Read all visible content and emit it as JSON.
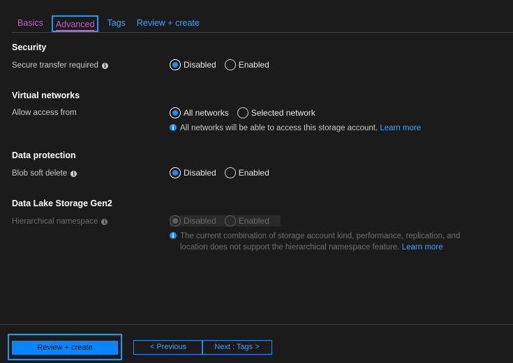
{
  "tabs": {
    "basics": "Basics",
    "advanced": "Advanced",
    "tags": "Tags",
    "review": "Review + create"
  },
  "security": {
    "title": "Security",
    "secure_transfer_label": "Secure transfer required",
    "option_disabled": "Disabled",
    "option_enabled": "Enabled",
    "selected": "Disabled"
  },
  "virtual_networks": {
    "title": "Virtual networks",
    "allow_access_label": "Allow access from",
    "option_all": "All networks",
    "option_selected": "Selected network",
    "selected": "All networks",
    "info_text": "All networks will be able to access this storage account.",
    "learn_more": "Learn more"
  },
  "data_protection": {
    "title": "Data protection",
    "blob_soft_delete_label": "Blob soft delete",
    "option_disabled": "Disabled",
    "option_enabled": "Enabled",
    "selected": "Disabled"
  },
  "data_lake": {
    "title": "Data Lake Storage Gen2",
    "hierarchical_label": "Hierarchical namespace",
    "option_disabled": "Disabled",
    "option_enabled": "Enabled",
    "selected": "Disabled",
    "info_line1": "The current combination of storage account kind, performance, replication, and",
    "info_line2": "location does not support the hierarchical namespace feature.",
    "learn_more": "Learn more"
  },
  "footer": {
    "review_create": "Review + create",
    "previous": "< Previous",
    "next": "Next : Tags >"
  },
  "colors": {
    "accent": "#0a84ff",
    "visited_link": "#c25fd0",
    "background": "#1b1b1c"
  },
  "icons": {
    "info": "info-icon",
    "radio": "radio-button"
  }
}
